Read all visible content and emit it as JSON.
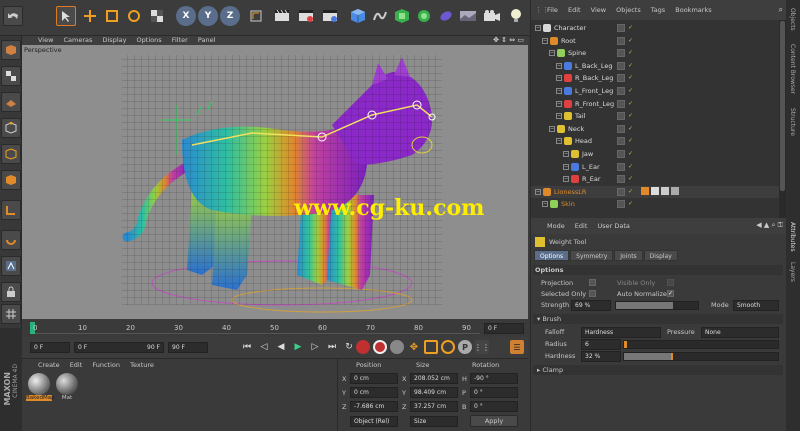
{
  "toolbar": {
    "axis_x": "X",
    "axis_y": "Y",
    "axis_z": "Z",
    "icons": [
      "undo-icon",
      "select-icon",
      "move-icon",
      "scale-icon",
      "rotate-icon",
      "checker-icon",
      "render-icon",
      "render-view-icon",
      "render-settings-icon",
      "cube-icon",
      "spline-icon",
      "nurbs-icon",
      "deformer-icon",
      "scene-icon",
      "camera-icon",
      "light-icon"
    ]
  },
  "viewport": {
    "menu": [
      "View",
      "Cameras",
      "Display",
      "Options",
      "Filter",
      "Panel"
    ],
    "label": "Perspective",
    "watermark": "www.cg-ku.com",
    "bg": "#8e8e8e"
  },
  "object_manager": {
    "menu": [
      "File",
      "Edit",
      "View",
      "Objects",
      "Tags",
      "Bookmarks"
    ],
    "items": [
      {
        "label": "Character",
        "color": "#d8d8d8",
        "indent": 0
      },
      {
        "label": "Root",
        "color": "#e08a2a",
        "indent": 1
      },
      {
        "label": "Spine",
        "color": "#8fd05a",
        "indent": 2
      },
      {
        "label": "L_Back_Leg",
        "color": "#4a7ae0",
        "indent": 3
      },
      {
        "label": "R_Back_Leg",
        "color": "#e04040",
        "indent": 3
      },
      {
        "label": "L_Front_Leg",
        "color": "#4a7ae0",
        "indent": 3
      },
      {
        "label": "R_Front_Leg",
        "color": "#e04040",
        "indent": 3
      },
      {
        "label": "Tail",
        "color": "#e0c030",
        "indent": 3
      },
      {
        "label": "Neck",
        "color": "#e0c030",
        "indent": 2
      },
      {
        "label": "Head",
        "color": "#e0c030",
        "indent": 3
      },
      {
        "label": "Jaw",
        "color": "#e0c030",
        "indent": 4
      },
      {
        "label": "L_Ear",
        "color": "#4a7ae0",
        "indent": 4
      },
      {
        "label": "R_Ear",
        "color": "#e04040",
        "indent": 4
      },
      {
        "label": "LionessLR",
        "color": "#e08a2a",
        "indent": 0
      },
      {
        "label": "Skin",
        "color": "#8fd05a",
        "indent": 1
      }
    ],
    "side_tabs": [
      "Objects",
      "Content Browser",
      "Structure"
    ]
  },
  "attributes": {
    "menu": [
      "Mode",
      "Edit",
      "User Data"
    ],
    "tool_name": "Weight Tool",
    "tabs": [
      "Options",
      "Symmetry",
      "Joints",
      "Display"
    ],
    "section": "Options",
    "projection_label": "Projection",
    "visible_only_label": "Visible Only",
    "selected_only_label": "Selected Only",
    "auto_normalize_label": "Auto Normalize",
    "strength_label": "Strength",
    "strength_value": "69 %",
    "strength_fill": 0.69,
    "mode_label": "Mode",
    "mode_value": "Smooth",
    "brush_section": "Brush",
    "falloff_label": "Falloff",
    "falloff_value": "Hardness",
    "pressure_label": "Pressure",
    "pressure_value": "None",
    "radius_label": "Radius",
    "radius_value": "6",
    "hardness_label": "Hardness",
    "hardness_value": "32 %",
    "hardness_fill": 0.32,
    "clamp_section": "Clamp",
    "side_tabs": [
      "Attributes",
      "Layers"
    ]
  },
  "timeline": {
    "ticks": [
      "0",
      "10",
      "20",
      "30",
      "40",
      "50",
      "60",
      "70",
      "80",
      "90"
    ],
    "frame_end": "0 F",
    "start_field": "0 F",
    "range_start": "0 F",
    "range_end": "90 F",
    "end_field": "90 F"
  },
  "materials": {
    "menu": [
      "Create",
      "Edit",
      "Function",
      "Texture"
    ],
    "items": [
      "BakedMap",
      "Mat"
    ]
  },
  "coordinates": {
    "headers": [
      "Position",
      "Size",
      "Rotation"
    ],
    "rows": [
      {
        "axis": "X",
        "pos": "0 cm",
        "size_axis": "X",
        "size": "208.052 cm",
        "rot_axis": "H",
        "rot": "-90 °"
      },
      {
        "axis": "Y",
        "pos": "0 cm",
        "size_axis": "Y",
        "size": "98.409 cm",
        "rot_axis": "P",
        "rot": "0 °"
      },
      {
        "axis": "Z",
        "pos": "-7.686 cm",
        "size_axis": "Z",
        "size": "37.257 cm",
        "rot_axis": "B",
        "rot": "0 °"
      }
    ],
    "coord_mode": "Object (Rel)",
    "size_mode": "Size",
    "apply_label": "Apply"
  },
  "brand": {
    "line1": "MAXON",
    "line2": "CINEMA 4D"
  }
}
